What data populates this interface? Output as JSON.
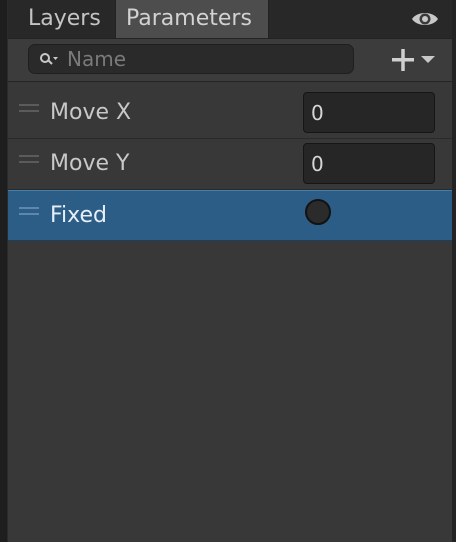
{
  "tabs": [
    {
      "label": "Layers",
      "active": false
    },
    {
      "label": "Parameters",
      "active": true
    }
  ],
  "search": {
    "placeholder": "Name",
    "value": ""
  },
  "parameters": [
    {
      "name": "Move X",
      "type": "float",
      "value": "0",
      "selected": false
    },
    {
      "name": "Move Y",
      "type": "float",
      "value": "0",
      "selected": false
    },
    {
      "name": "Fixed",
      "type": "bool",
      "value": false,
      "selected": true
    }
  ],
  "icons": {
    "visibility": "eye-icon",
    "search": "search-icon",
    "add": "plus-icon",
    "dropdown": "chevron-down-icon",
    "drag": "drag-handle-icon"
  },
  "colors": {
    "panel_bg": "#383838",
    "tab_active_bg": "#4d4d4d",
    "selected_row": "#2c5d87",
    "field_bg": "#262626"
  }
}
